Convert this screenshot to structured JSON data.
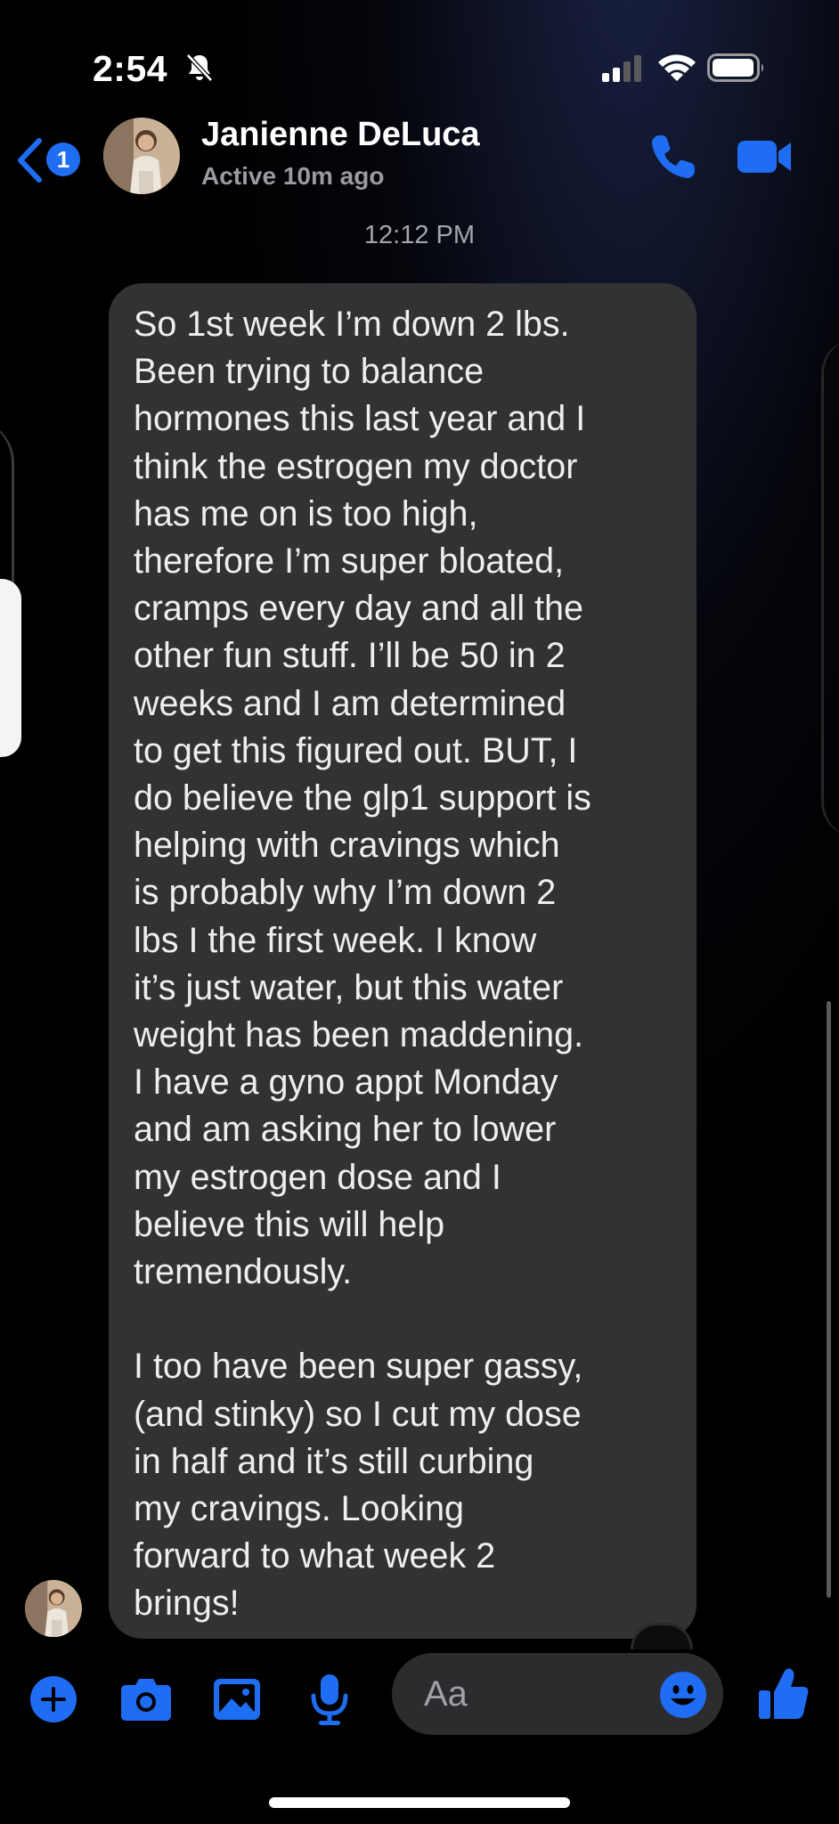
{
  "status_bar": {
    "time": "2:54",
    "icons": [
      "bell-slash-icon",
      "signal-icon",
      "wifi-icon",
      "battery-icon"
    ]
  },
  "header": {
    "unread_count": "1",
    "contact_name": "Janienne DeLuca",
    "active_status": "Active 10m ago",
    "icons": [
      "back-chevron-icon",
      "phone-icon",
      "video-camera-icon"
    ]
  },
  "conversation": {
    "timestamp": "12:12 PM",
    "message": "So 1st week I’m down 2 lbs.\nBeen trying to balance\nhormones this last year and I\nthink the estrogen my doctor\nhas me on is too high,\ntherefore I’m super bloated,\ncramps every day and all the\nother fun stuff. I’ll be 50 in 2\nweeks and I am determined\nto get this figured out. BUT, I\ndo believe the glp1 support is\nhelping with cravings which\nis probably why I’m down 2\nlbs I the first week. I know\nit’s just water, but this water\nweight has been maddening.\nI have a gyno appt Monday\nand am asking her to lower\nmy estrogen dose and I\nbelieve this will help\ntremendously.\n\nI too have been super gassy,\n(and stinky) so I cut my dose\nin half and it’s still curbing\nmy cravings. Looking\nforward to what week 2\nbrings!"
  },
  "composer": {
    "placeholder": "Aa",
    "icons": [
      "plus-icon",
      "camera-icon",
      "image-icon",
      "microphone-icon",
      "emoji-icon",
      "thumbs-up-icon"
    ]
  },
  "colors": {
    "accent": "#1e6df2",
    "bubble": "#323235",
    "background": "#000000"
  }
}
